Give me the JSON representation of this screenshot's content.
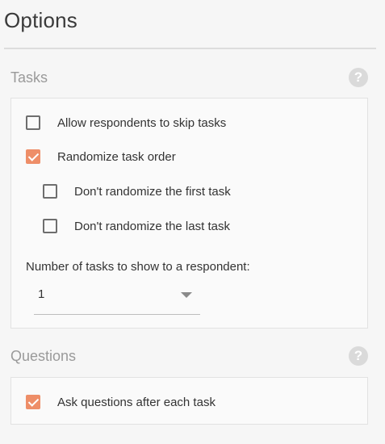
{
  "panel": {
    "title": "Options"
  },
  "tasks_section": {
    "header": "Tasks",
    "help_icon": "?",
    "options": [
      {
        "label": "Allow respondents to skip tasks",
        "checked": false
      },
      {
        "label": "Randomize task order",
        "checked": true
      },
      {
        "label": "Don't randomize the first task",
        "checked": false
      },
      {
        "label": "Don't randomize the last task",
        "checked": false
      }
    ],
    "tasks_count": {
      "label": "Number of tasks to show to a respondent:",
      "value": "1"
    }
  },
  "questions_section": {
    "header": "Questions",
    "help_icon": "?",
    "options": [
      {
        "label": "Ask questions after each task",
        "checked": true
      }
    ]
  },
  "colors": {
    "accent": "#ee8e68",
    "background": "#f6f6f6",
    "muted_text": "#9a9a9a"
  }
}
